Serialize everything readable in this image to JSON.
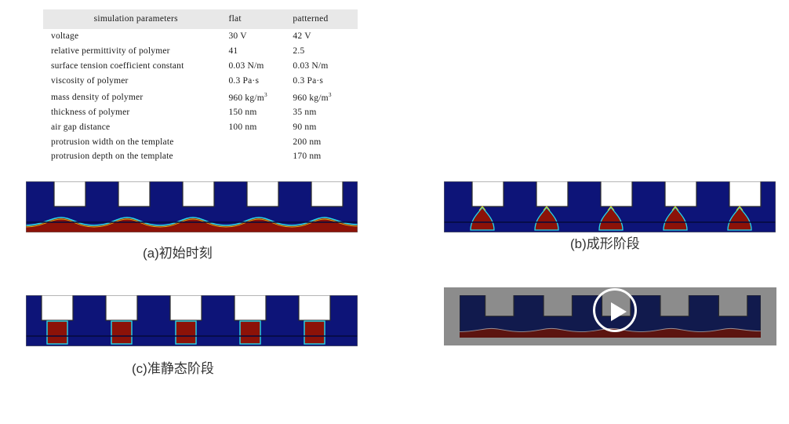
{
  "table": {
    "headers": [
      "simulation parameters",
      "flat",
      "patterned"
    ],
    "rows": [
      {
        "name": "voltage",
        "flat": "30 V",
        "patterned": "42 V"
      },
      {
        "name": "relative permittivity of polymer",
        "flat": "41",
        "patterned": "2.5"
      },
      {
        "name": "surface tension coefficient constant",
        "flat": "0.03 N/m",
        "patterned": "0.03 N/m"
      },
      {
        "name": "viscosity of polymer",
        "flat": "0.3 Pa·s",
        "patterned": "0.3 Pa·s"
      },
      {
        "name": "mass density of polymer",
        "flat_base": "960 kg/m",
        "flat_sup": "3",
        "patterned_base": "960 kg/m",
        "patterned_sup": "3"
      },
      {
        "name": "thickness of polymer",
        "flat": "150 nm",
        "patterned": "35 nm"
      },
      {
        "name": "air gap distance",
        "flat": "100 nm",
        "patterned": "90 nm"
      },
      {
        "name": "protrusion width on the template",
        "flat": "",
        "patterned": "200 nm"
      },
      {
        "name": "protrusion depth on the template",
        "flat": "",
        "patterned": "170 nm"
      }
    ]
  },
  "panels": {
    "a": {
      "caption": "(a)初始时刻"
    },
    "b": {
      "caption": "(b)成形阶段"
    },
    "c": {
      "caption": "(c)准静态阶段"
    },
    "d": {
      "play_label": "播放"
    }
  },
  "colors": {
    "template_blue": "#0d1478",
    "polymer_red": "#8c1208",
    "interface_cyan": "#27d9e8",
    "interface_yellow": "#e8d317",
    "header_gray": "#e8e8e8",
    "video_overlay_gray": "#8c8c8c",
    "play_white": "#ffffff",
    "outline_dark": "#2b2b2b"
  }
}
